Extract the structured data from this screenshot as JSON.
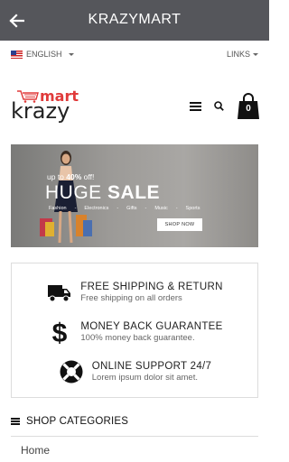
{
  "appbar": {
    "title": "KRAZYMART",
    "back_icon": "arrow-left-icon"
  },
  "topbar": {
    "language": "ENGLISH",
    "links": "LINKS"
  },
  "logo": {
    "top_text": "mart",
    "bottom_text": "krazy"
  },
  "header": {
    "cart_count": "0"
  },
  "banner": {
    "upto_prefix": "up to ",
    "upto_value": "40%",
    "upto_suffix": " off!",
    "huge": "HUGE",
    "sale": "SALE",
    "categories": [
      "Fashion",
      "Electronics",
      "Gifts",
      "Music",
      "Sports"
    ],
    "shop_now": "SHOP NOW"
  },
  "features": [
    {
      "title": "FREE SHIPPING & RETURN",
      "subtitle": "Free shipping on all orders",
      "icon": "truck-icon"
    },
    {
      "title": "MONEY BACK GUARANTEE",
      "subtitle": "100% money back guarantee.",
      "icon": "dollar-icon"
    },
    {
      "title": "ONLINE SUPPORT 24/7",
      "subtitle": "Lorem ipsum dolor sit amet.",
      "icon": "lifebuoy-icon"
    }
  ],
  "shop_categories": {
    "heading": "SHOP CATEGORIES",
    "items": [
      "Home"
    ]
  },
  "colors": {
    "appbar": "#55565b",
    "accent": "#e03a3a"
  }
}
